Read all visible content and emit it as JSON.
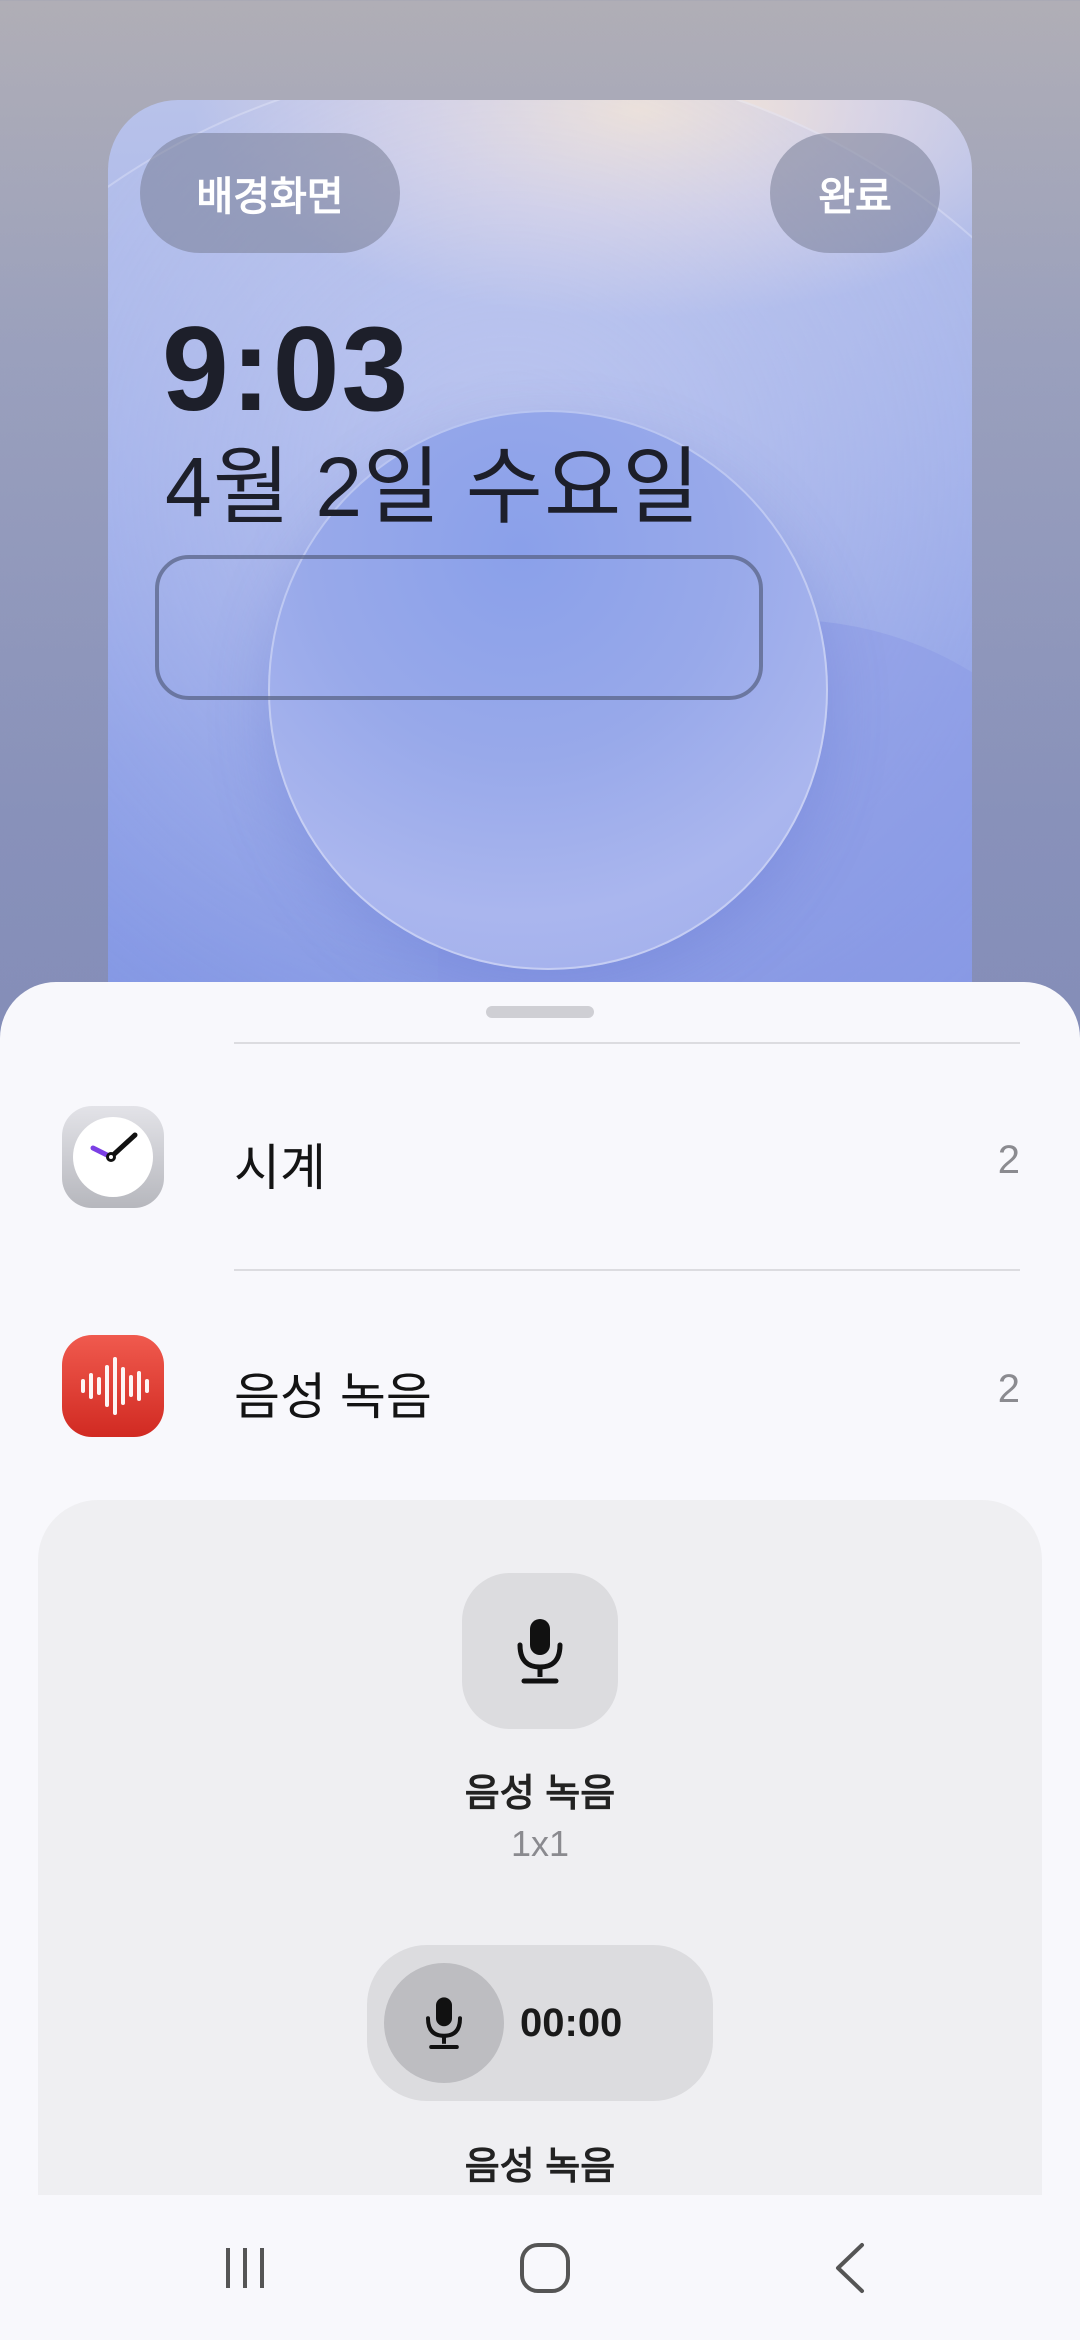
{
  "lockscreen": {
    "wallpaper_button": "배경화면",
    "done_button": "완료",
    "time": "9:03",
    "date": "4월 2일 수요일"
  },
  "apps": [
    {
      "name": "시계",
      "count": "2",
      "icon": "clock-icon"
    },
    {
      "name": "음성 녹음",
      "count": "2",
      "icon": "voice-recorder-icon"
    }
  ],
  "widgets": [
    {
      "title": "음성 녹음",
      "size": "1x1",
      "icon": "mic-icon"
    },
    {
      "title": "음성 녹음",
      "timer": "00:00",
      "icon": "mic-icon"
    }
  ],
  "navbar": {
    "recent_icon": "recent-apps-icon",
    "home_icon": "home-icon",
    "back_icon": "back-icon"
  },
  "colors": {
    "voice_red": "#e0372e",
    "clock_hand_purple": "#7b3fe4"
  }
}
